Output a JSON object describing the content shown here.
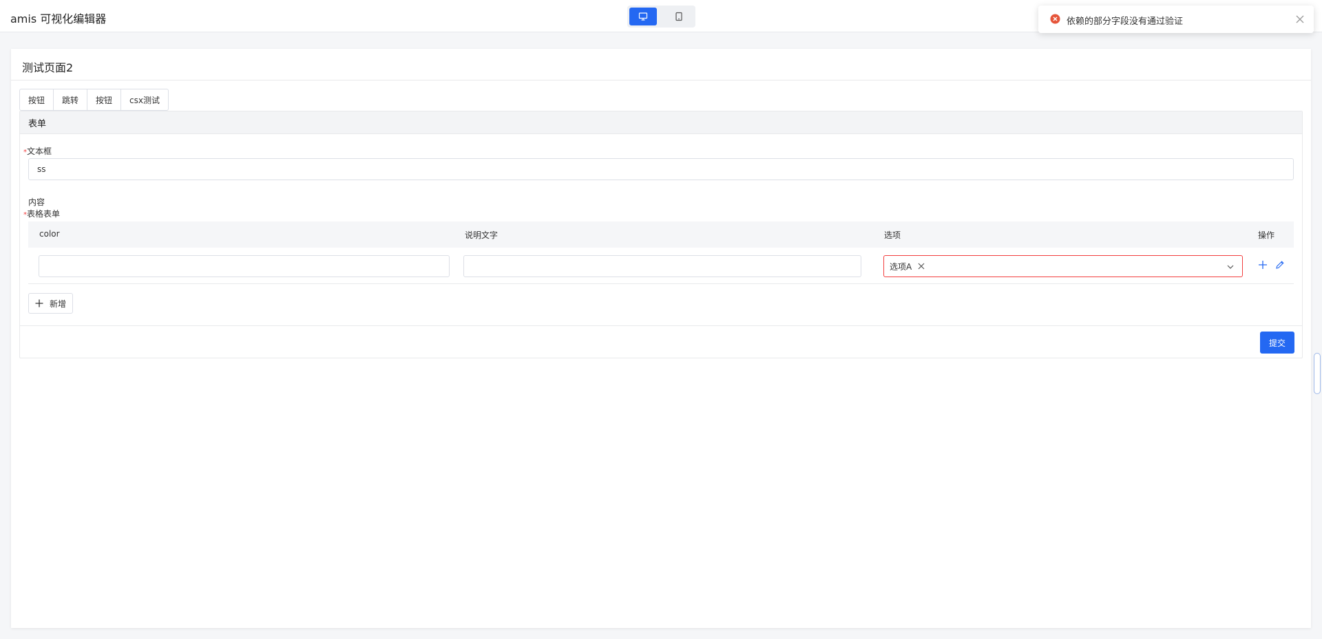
{
  "app": {
    "title": "amis 可视化编辑器"
  },
  "device_switch": {
    "pc_icon": "monitor-icon",
    "mobile_icon": "tablet-icon",
    "active": "pc"
  },
  "toast": {
    "message": "依赖的部分字段没有通过验证",
    "icon": "error-circle-icon",
    "close_icon": "close-icon",
    "type": "error"
  },
  "page": {
    "title": "测试页面2"
  },
  "buttons": [
    {
      "label": "按钮"
    },
    {
      "label": "跳转"
    },
    {
      "label": "按钮"
    },
    {
      "label": "csx测试"
    }
  ],
  "form": {
    "title": "表单",
    "required_mark": "*",
    "text_field": {
      "label": "文本框",
      "value": "ss"
    },
    "content_label": "内容",
    "table_field": {
      "label": "表格表单"
    },
    "table": {
      "columns": [
        "color",
        "说明文字",
        "选项",
        "操作"
      ],
      "rows": [
        {
          "color": "",
          "desc": "",
          "option_tag": "选项A"
        }
      ]
    },
    "add_label": "新增",
    "submit_label": "提交"
  },
  "colors": {
    "primary": "#2468f2",
    "error": "#f23d3d"
  }
}
